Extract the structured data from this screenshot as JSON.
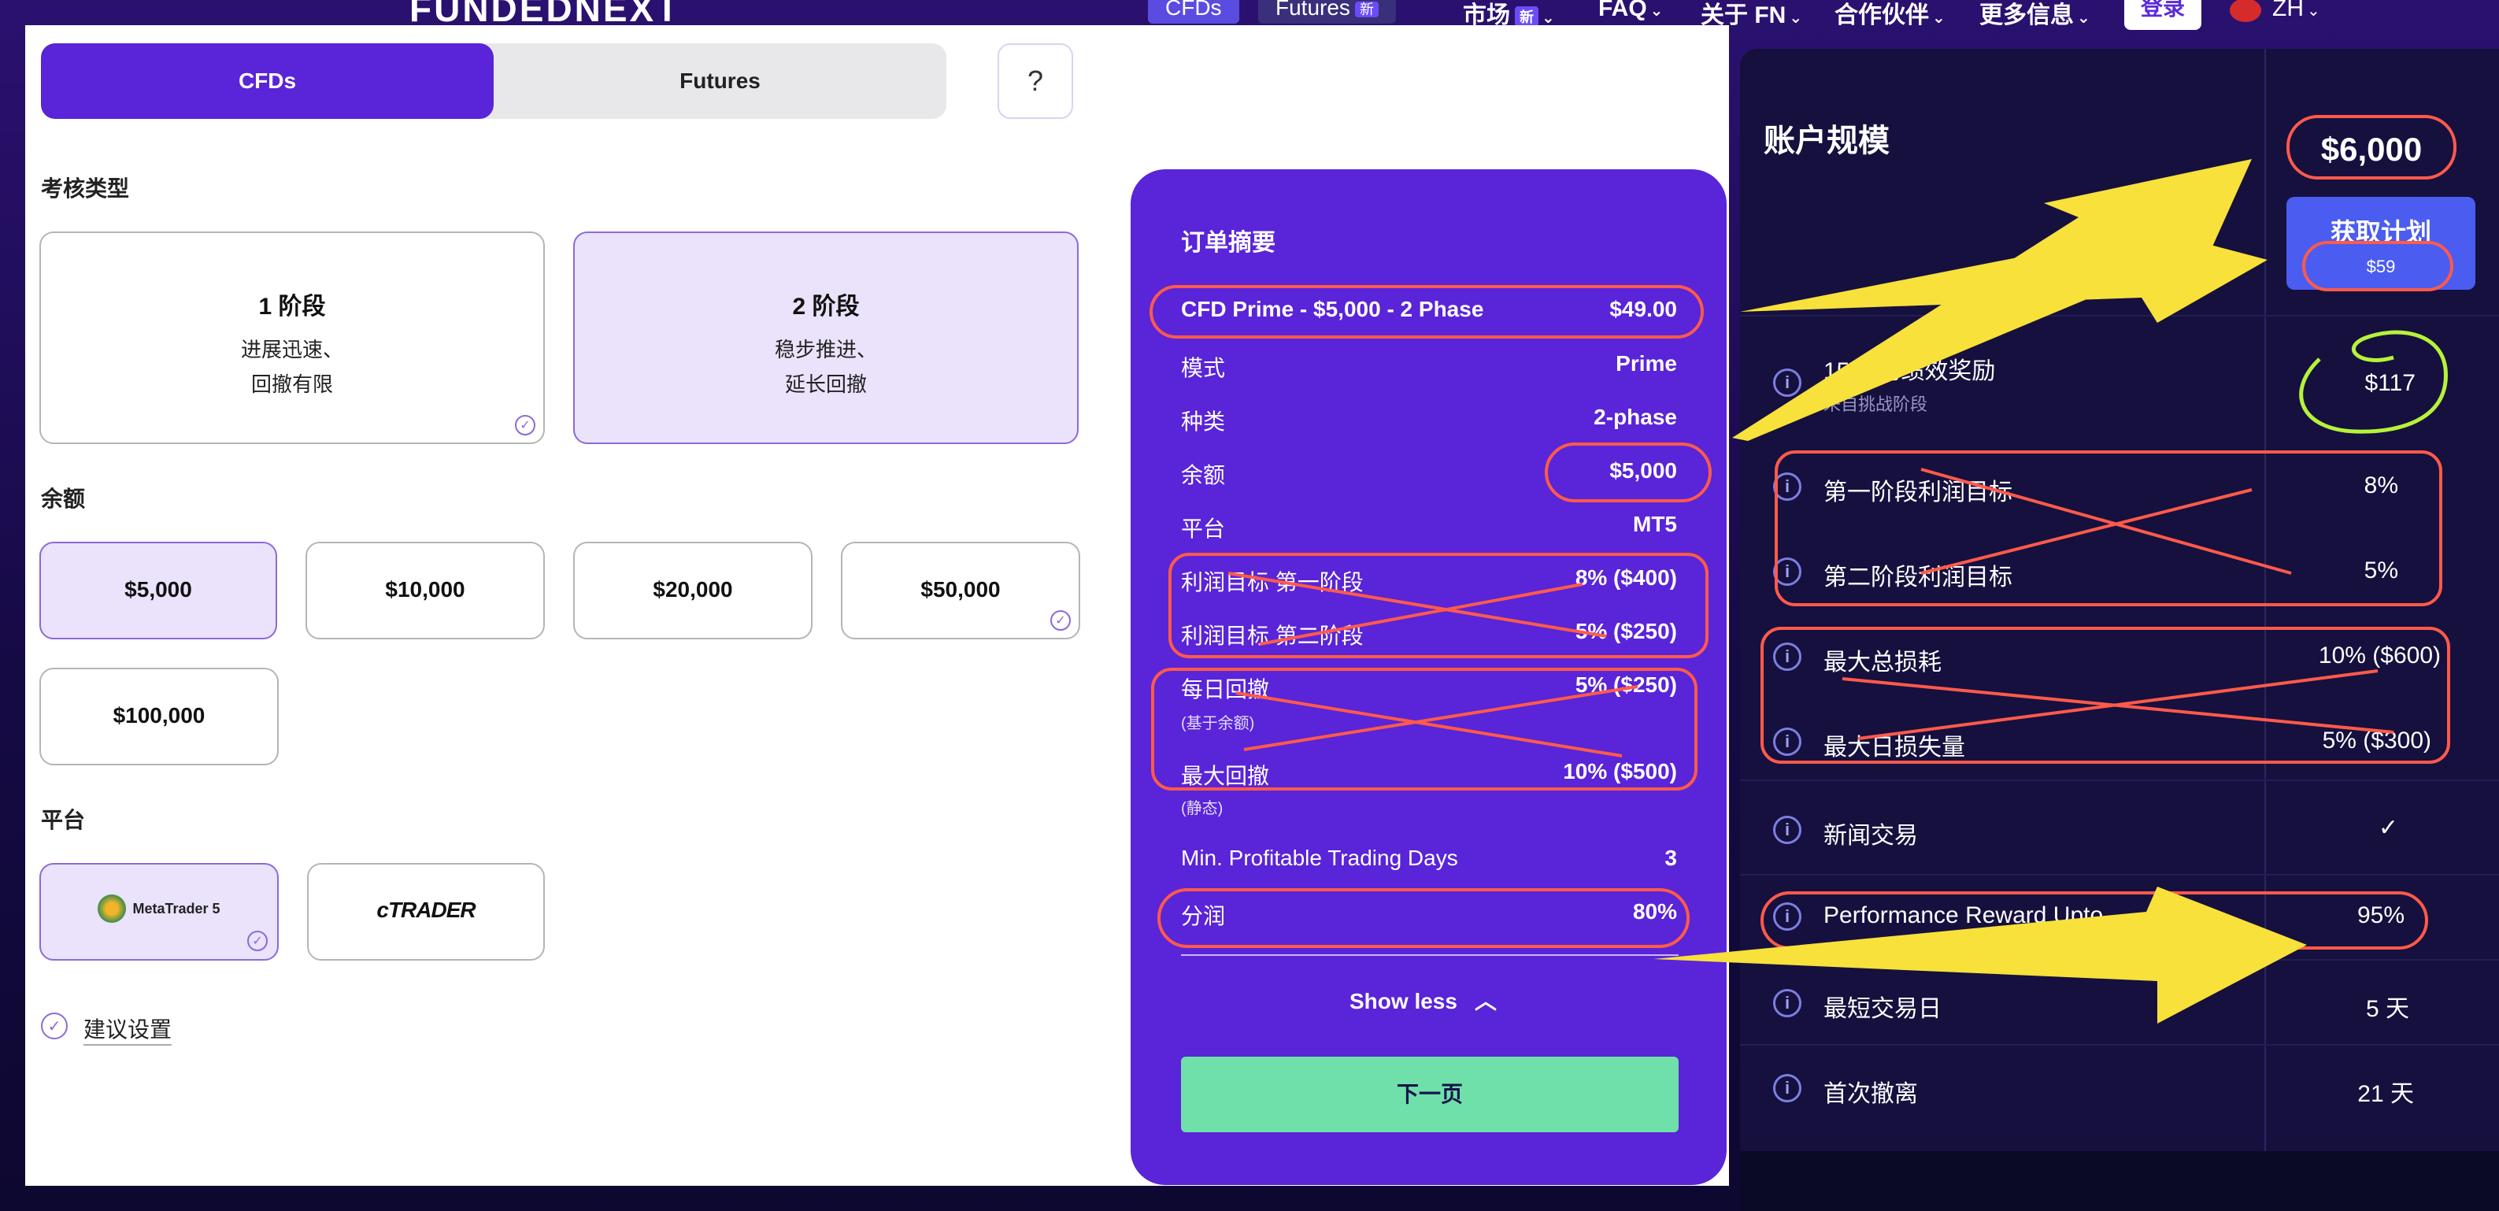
{
  "nav": {
    "logo": "FUNDEDNEXT",
    "pill_cfds": "CFDs",
    "pill_futures": "Futures",
    "badge_new": "新",
    "market": "市场",
    "faq": "FAQ",
    "about": "关于 FN",
    "partner": "合作伙伴",
    "more": "更多信息",
    "login": "登录",
    "lang": "ZH"
  },
  "tabs": {
    "cfds": "CFDs",
    "futures": "Futures",
    "help": "?"
  },
  "assessment": {
    "label": "考核类型",
    "one": {
      "title": "1 阶段",
      "desc1": "进展迅速、",
      "desc2": "回撤有限"
    },
    "two": {
      "title": "2 阶段",
      "desc1": "稳步推进、",
      "desc2": "延长回撤"
    }
  },
  "balance": {
    "label": "余额",
    "options": [
      "$5,000",
      "$10,000",
      "$20,000",
      "$50,000",
      "$100,000"
    ]
  },
  "platform": {
    "label": "平台",
    "mt5": "MetaTrader 5",
    "ctrader": "cTRADER"
  },
  "recommended": "建议设置",
  "summary": {
    "title": "订单摘要",
    "product": "CFD Prime - $5,000 - 2 Phase",
    "product_price": "$49.00",
    "rows": [
      {
        "label": "模式",
        "value": "Prime"
      },
      {
        "label": "种类",
        "value": "2-phase"
      },
      {
        "label": "余额",
        "value": "$5,000"
      },
      {
        "label": "平台",
        "value": "MT5"
      },
      {
        "label": "利润目标 第一阶段",
        "value": "8% ($400)"
      },
      {
        "label": "利润目标 第二阶段",
        "value": "5% ($250)"
      },
      {
        "label": "每日回撤",
        "value": "5% ($250)"
      },
      {
        "label": "最大回撤",
        "value": "10% ($500)"
      },
      {
        "label": "Min. Profitable Trading Days",
        "value": "3"
      },
      {
        "label": "分润",
        "value": "80%"
      }
    ],
    "daily_note": "(基于余额)",
    "max_note": "(静态)",
    "show_less": "Show less",
    "next": "下一页"
  },
  "right": {
    "title": "账户规模",
    "price": "$6,000",
    "plan_btn": "获取计划",
    "plan_price": "$59",
    "rows": [
      {
        "label": "15% 的绩效奖励",
        "sub": "来自挑战阶段",
        "value": "$117"
      },
      {
        "label": "第一阶段利润目标",
        "value": "8%"
      },
      {
        "label": "第二阶段利润目标",
        "value": "5%"
      },
      {
        "label": "最大总损耗",
        "value": "10% ($600)"
      },
      {
        "label": "最大日损失量",
        "value": "5% ($300)"
      },
      {
        "label": "新闻交易",
        "value": "✓"
      },
      {
        "label": "Performance Reward Upto",
        "value": "95%"
      },
      {
        "label": "最短交易日",
        "value": "5 天"
      },
      {
        "label": "首次撤离",
        "value": "21 天"
      }
    ]
  },
  "colors": {
    "accent": "#5a24d8",
    "next_button": "#6fe0a9",
    "annotation_red": "#ff5a4a",
    "annotation_yellow": "#f7e13a",
    "annotation_green": "#b7f23a"
  }
}
